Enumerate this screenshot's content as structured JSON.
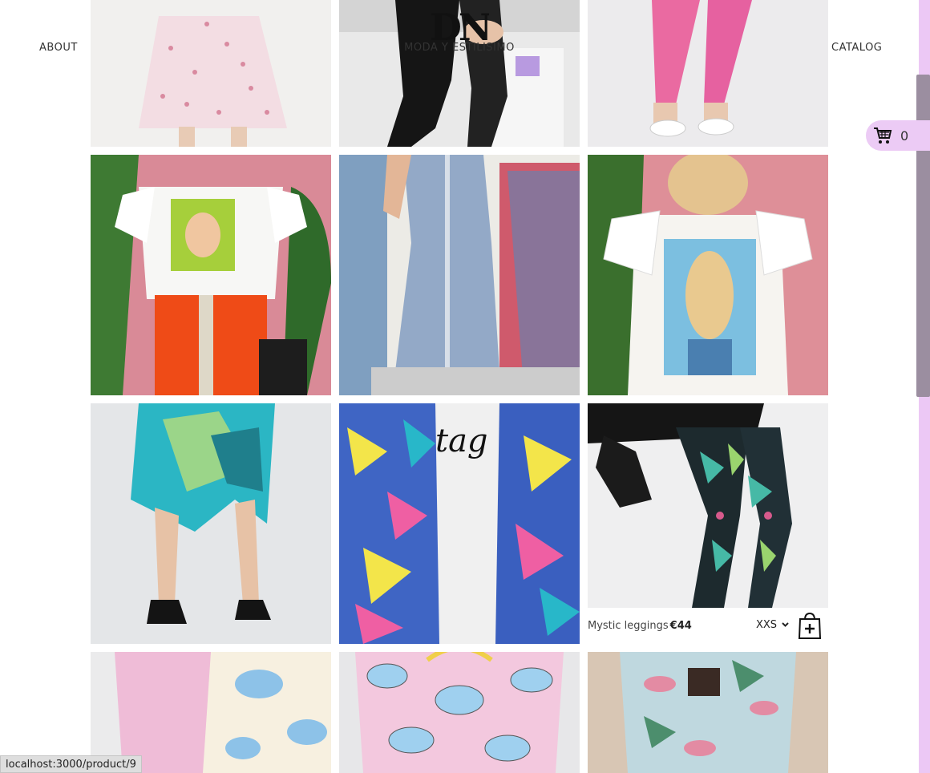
{
  "header": {
    "about": "ABOUT",
    "logo": "DN",
    "subtitle": "MODA Y ESTILISIMO",
    "catalog": "CATALOG"
  },
  "cart": {
    "icon": "cart-icon",
    "count": "0"
  },
  "products": [
    {
      "id": "row0-col0",
      "alt": "floral skirt"
    },
    {
      "id": "row0-col1",
      "alt": "leather pants"
    },
    {
      "id": "row0-col2",
      "alt": "pink trousers"
    },
    {
      "id": "row1-col0",
      "alt": "printed ruffle tee"
    },
    {
      "id": "row1-col1",
      "alt": "denim dress"
    },
    {
      "id": "row1-col2",
      "alt": "lace sleeve tee"
    },
    {
      "id": "row2-col0",
      "alt": "tie-dye skirt"
    },
    {
      "id": "row2-col1",
      "alt": "tropical jacket"
    },
    {
      "id": "row2-col2",
      "alt": "Mystic leggings"
    },
    {
      "id": "row3-col0",
      "alt": "pink trousers"
    },
    {
      "id": "row3-col1",
      "alt": "cloud print top"
    },
    {
      "id": "row3-col2",
      "alt": "tropical top"
    }
  ],
  "hovered_product": {
    "name": "Mystic leggings",
    "price": "€44",
    "size": "XXS",
    "add_icon": "add-to-bag-icon"
  },
  "status_bar": {
    "url": "localhost:3000/product/9"
  },
  "colors": {
    "accent": "#ecc8f5",
    "scroll": "#9b8ea0"
  }
}
